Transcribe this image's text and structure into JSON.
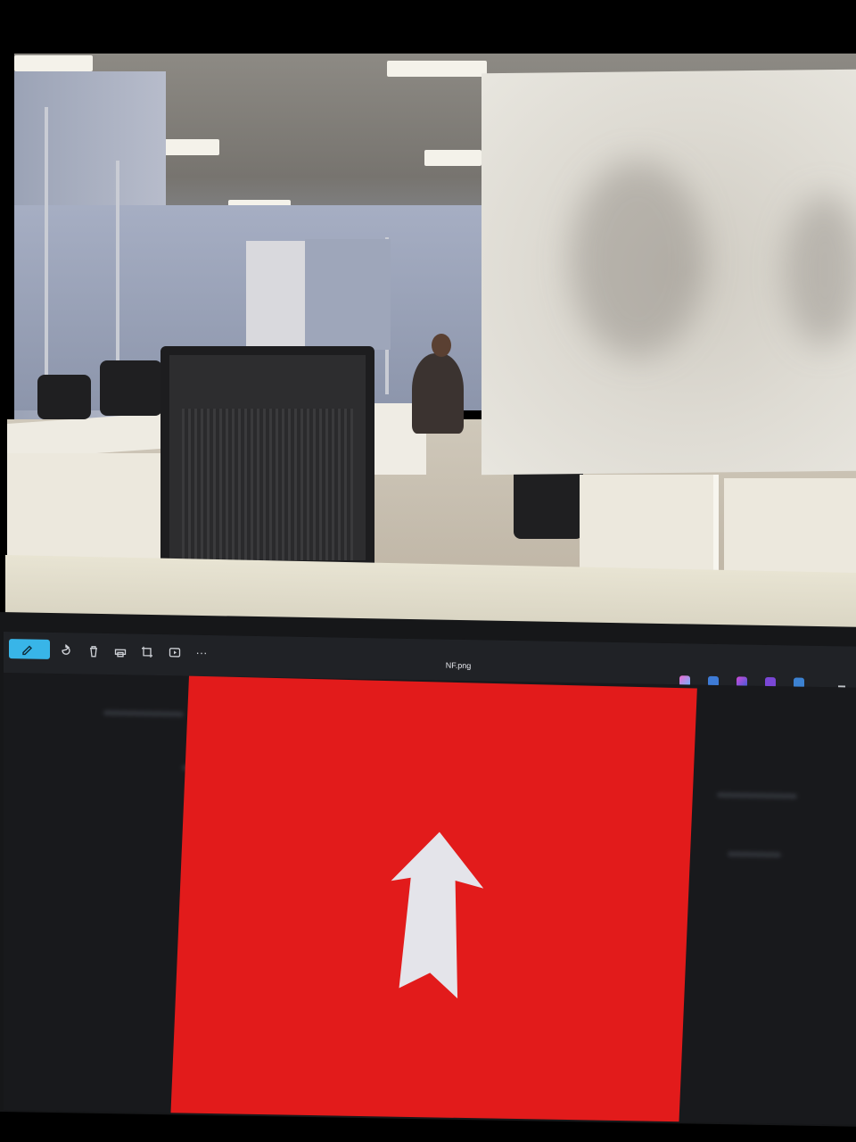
{
  "viewer": {
    "file_name": "NF.png",
    "toolbar": [
      {
        "name": "edit-image-icon",
        "label": ""
      },
      {
        "name": "rotate-icon",
        "label": ""
      },
      {
        "name": "delete-icon",
        "label": ""
      },
      {
        "name": "print-icon",
        "label": ""
      },
      {
        "name": "crop-icon",
        "label": ""
      },
      {
        "name": "slideshow-icon",
        "label": ""
      },
      {
        "name": "more-icon",
        "label": "···"
      }
    ],
    "image": {
      "background_color": "#e21b1b",
      "icon": "up-arrow-icon",
      "icon_color": "#e4e4ea"
    },
    "accent_color": "#38b5e8"
  }
}
